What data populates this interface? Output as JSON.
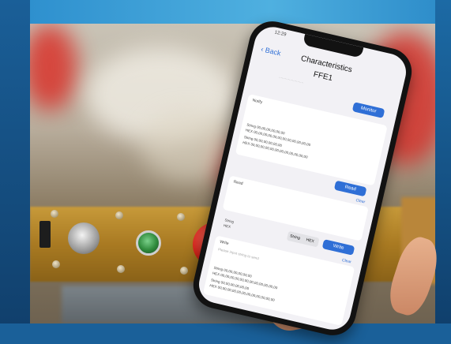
{
  "screen": {
    "time": "12:29",
    "back_label": "Back",
    "nav_title": "Characteristics",
    "characteristic_name": "FFE1",
    "monitor_button": "Monitor",
    "notify_label": "Notify",
    "notify_lines": [
      "String 00,00,00,00,00,00",
      "HEX 00,00,00,00,00,00,00,00,00,00,00,00",
      "String 00,00,00,00,00,00",
      "HEX 00,00,00,00,00,00,00,00,00,00,00,00"
    ],
    "read_button": "Read",
    "clear_label": "Clear",
    "read_label": "Read",
    "write_mode_string": "String",
    "write_mode_hex": "HEX",
    "write_button": "Write",
    "write_label": "Write",
    "write_placeholder": "Please input string to send",
    "write_value_lines": [
      "String 00,00,00,00,00,00",
      "HEX 00,00,00,00,00,00,00,00,00,00,00,00",
      "String 00,00,00,00,00,00",
      "HEX 00,00,00,00,00,00,00,00,00,00,00,00"
    ]
  },
  "colors": {
    "frame_blue": "#2d8fc9",
    "accent_blue": "#2f6fd6",
    "panel_gold": "#c79a3a",
    "button_red": "#d8221a",
    "button_green": "#2f8a3c"
  }
}
